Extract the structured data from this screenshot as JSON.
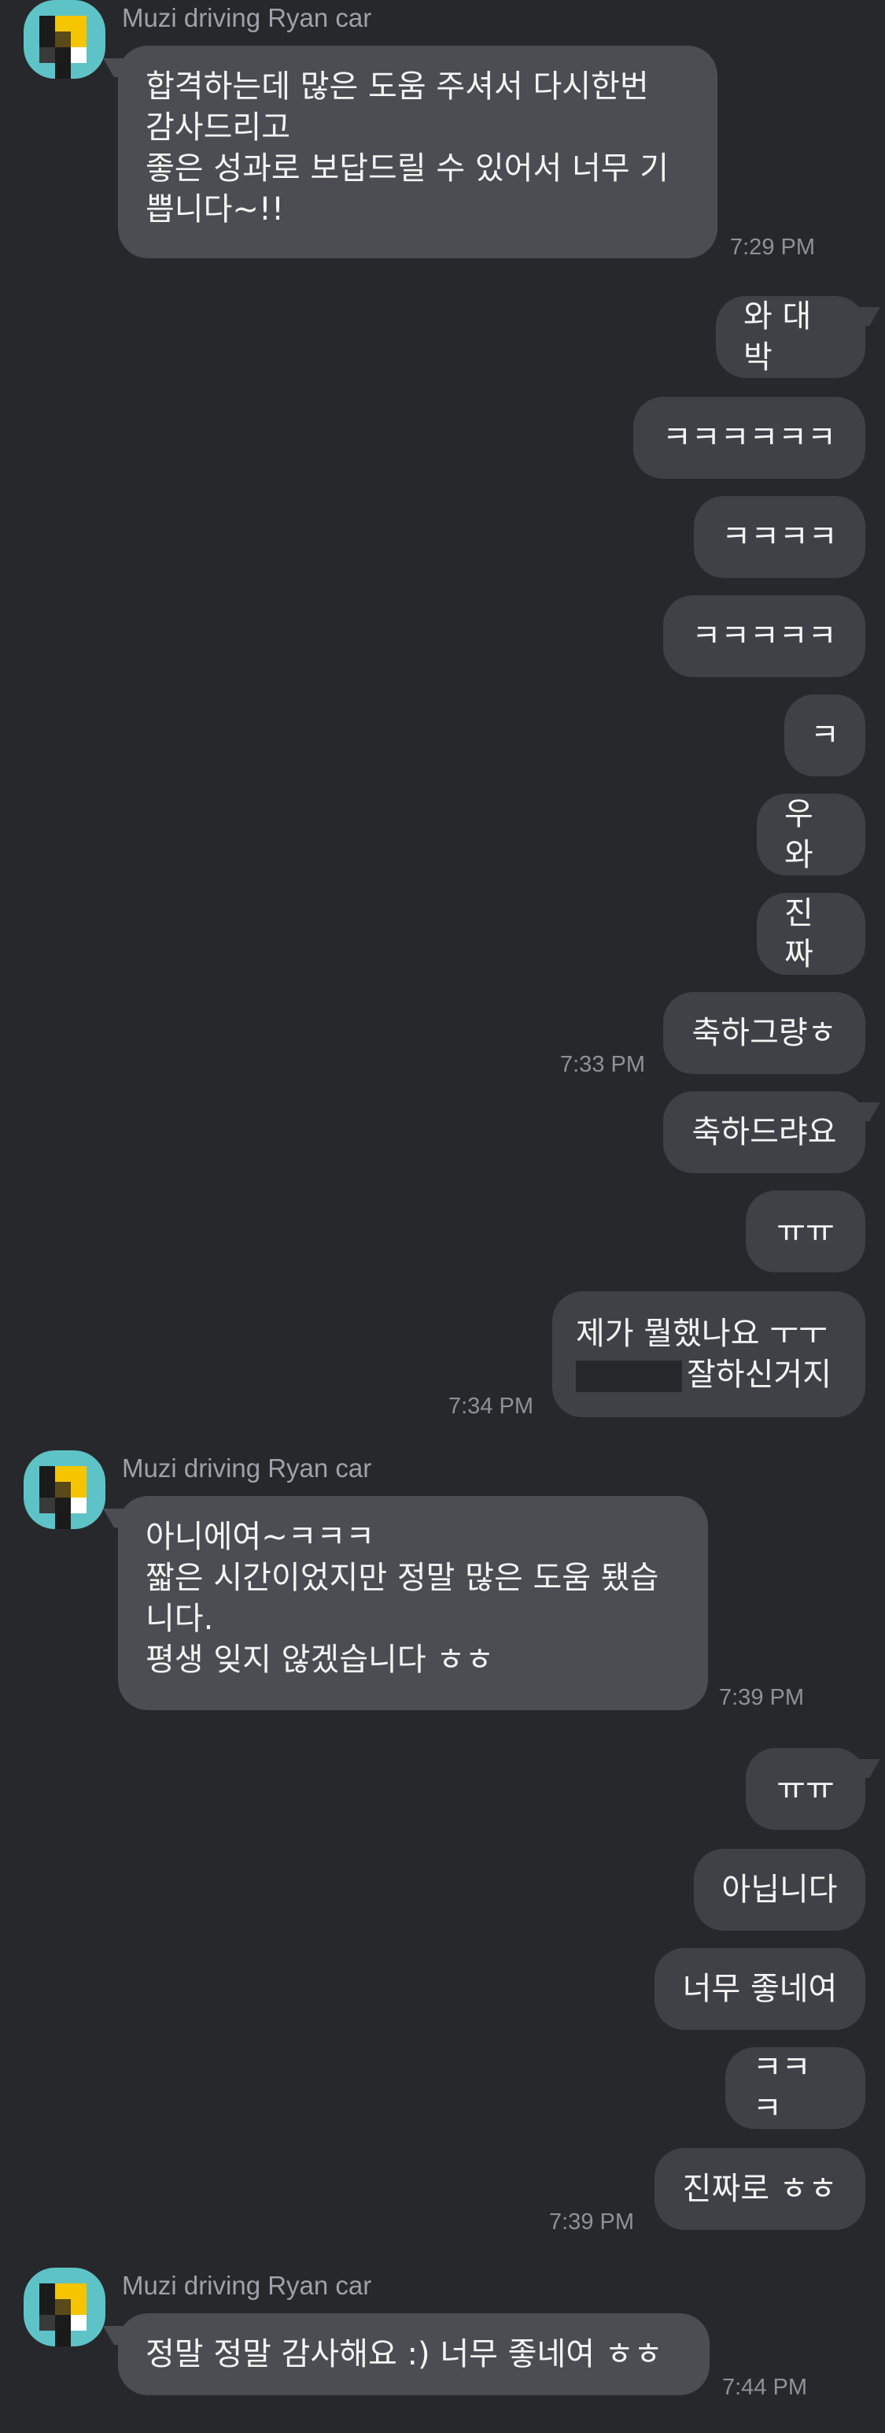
{
  "conversation": {
    "sender_name": "Muzi driving Ryan car",
    "groups": [
      {
        "messages": [
          "합격하는데 많은 도움 주셔서 다시한번\n감사드리고\n좋은 성과로 보답드릴 수 있어서 너무 기\n쁩니다~!!"
        ],
        "time": "7:29 PM"
      },
      {
        "messages": [
          "와 대박",
          "ㅋㅋㅋㅋㅋㅋ",
          "ㅋㅋㅋㅋ",
          "ㅋㅋㅋㅋㅋ",
          "ㅋ",
          "우와",
          "진짜",
          "축하그량ㅎ"
        ],
        "time": "7:33 PM"
      },
      {
        "messages": [
          "축하드랴요",
          "ㅠㅠ",
          "제가 뭘했나요 ㅜㅜ",
          "잘하신거지"
        ],
        "time": "7:34 PM"
      },
      {
        "messages": [
          "아니에여~ㅋㅋㅋ\n짧은 시간이었지만 정말 많은 도움 됐습\n니다.\n평생 잊지 않겠습니다 ㅎㅎ"
        ],
        "time": "7:39 PM"
      },
      {
        "messages": [
          "ㅠㅠ",
          "아닙니다",
          "너무 좋네여",
          "ㅋㅋㅋ",
          "진짜로 ㅎㅎ"
        ],
        "time": "7:39 PM"
      },
      {
        "messages": [
          "정말 정말 감사해요 :) 너무 좋네여 ㅎㅎ"
        ],
        "time": "7:44 PM"
      }
    ]
  },
  "colors": {
    "background": "#27282c",
    "bubble_incoming": "#4b4d52",
    "bubble_outgoing": "#3f4146",
    "avatar_bg": "#5ec3c6",
    "text": "#f4f4f4",
    "meta_text": "#8e9196"
  }
}
